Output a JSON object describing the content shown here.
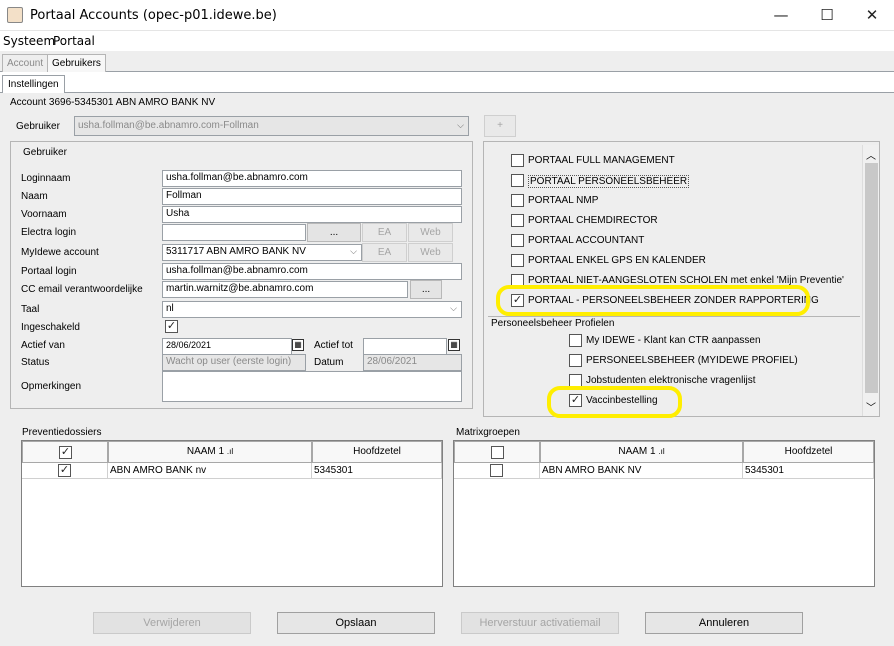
{
  "window": {
    "title": "Portaal Accounts (opec-p01.idewe.be)",
    "minimize": "—",
    "maximize": "☐",
    "close": "✕"
  },
  "menu": [
    "Systeem",
    "Portaal"
  ],
  "tabs": [
    "Account",
    "Gebruikers"
  ],
  "subtab": "Instellingen",
  "account_label": "Account 3696-5345301 ABN AMRO BANK NV",
  "gebruiker_select": {
    "label": "Gebruiker",
    "value": "usha.follman@be.abnamro.com-Follman",
    "add": "+"
  },
  "form": {
    "section": "Gebruiker",
    "loginnaam": {
      "label": "Loginnaam",
      "value": "usha.follman@be.abnamro.com"
    },
    "naam": {
      "label": "Naam",
      "value": "Follman"
    },
    "voornaam": {
      "label": "Voornaam",
      "value": "Usha"
    },
    "electra": {
      "label": "Electra login",
      "value": "",
      "dots": "...",
      "ea": "EA",
      "web": "Web"
    },
    "myidewe": {
      "label": "MyIdewe account",
      "value": "5311717 ABN AMRO BANK NV",
      "ea": "EA",
      "web": "Web"
    },
    "portaal_login": {
      "label": "Portaal login",
      "value": "usha.follman@be.abnamro.com"
    },
    "cc_email": {
      "label": "CC email verantwoordelijke",
      "value": "martin.warnitz@be.abnamro.com",
      "dots": "..."
    },
    "taal": {
      "label": "Taal",
      "value": "nl"
    },
    "ingeschakeld": {
      "label": "Ingeschakeld",
      "checked": "✓"
    },
    "actief_van": {
      "label": "Actief van",
      "value": "28/06/2021"
    },
    "actief_tot": {
      "label": "Actief tot",
      "value": ""
    },
    "status": {
      "label": "Status",
      "value": "Wacht op user (eerste login)"
    },
    "datum": {
      "label": "Datum",
      "value": "28/06/2021"
    },
    "opmerkingen": {
      "label": "Opmerkingen",
      "value": ""
    }
  },
  "profielen": {
    "items": [
      {
        "label": "PORTAAL FULL MANAGEMENT",
        "checked": ""
      },
      {
        "label": "PORTAAL PERSONEELSBEHEER",
        "checked": ""
      },
      {
        "label": "PORTAAL NMP",
        "checked": ""
      },
      {
        "label": "PORTAAL CHEMDIRECTOR",
        "checked": ""
      },
      {
        "label": "PORTAAL ACCOUNTANT",
        "checked": ""
      },
      {
        "label": "PORTAAL ENKEL GPS EN KALENDER",
        "checked": ""
      },
      {
        "label": "PORTAAL NIET-AANGESLOTEN SCHOLEN met enkel 'Mijn Preventie'",
        "checked": ""
      },
      {
        "label": "PORTAAL - PERSONEELSBEHEER ZONDER RAPPORTERING",
        "checked": "✓"
      }
    ],
    "sub_heading": "Personeelsbeheer Profielen",
    "sub_items": [
      {
        "label": "My IDEWE - Klant kan CTR aanpassen",
        "checked": ""
      },
      {
        "label": "PERSONEELSBEHEER (MYIDEWE PROFIEL)",
        "checked": ""
      },
      {
        "label": "Jobstudenten elektronische vragenlijst",
        "checked": ""
      },
      {
        "label": "Vaccinbestelling",
        "checked": "✓"
      }
    ]
  },
  "preventiedossiers": {
    "title": "Preventiedossiers",
    "columns": [
      "NAAM 1",
      "Hoofdzetel"
    ],
    "header_checked": "✓",
    "rows": [
      {
        "checked": "✓",
        "naam": "ABN AMRO BANK nv",
        "hoofdzetel": "5345301"
      }
    ]
  },
  "matrixgroepen": {
    "title": "Matrixgroepen",
    "columns": [
      "NAAM 1",
      "Hoofdzetel"
    ],
    "header_checked": "",
    "rows": [
      {
        "checked": "",
        "naam": "ABN AMRO BANK NV",
        "hoofdzetel": "5345301"
      }
    ]
  },
  "buttons": {
    "verwijderen": "Verwijderen",
    "opslaan": "Opslaan",
    "herverstuur": "Herverstuur activatiemail",
    "annuleren": "Annuleren"
  },
  "colors": {
    "highlight": "#ffee00"
  }
}
